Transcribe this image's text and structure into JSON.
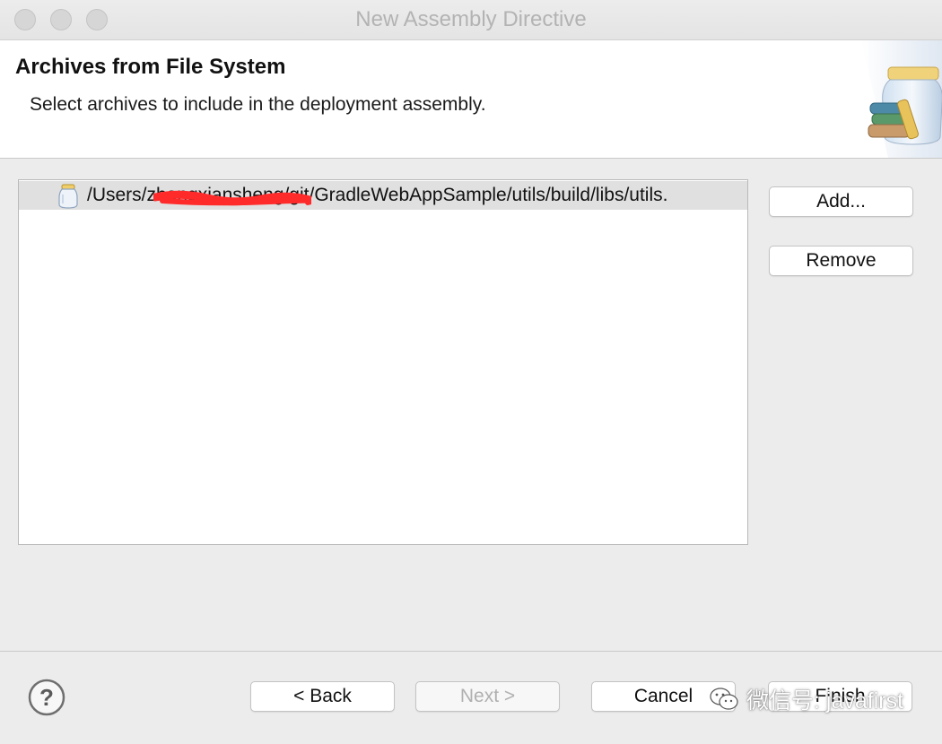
{
  "window": {
    "title": "New Assembly Directive"
  },
  "header": {
    "title": "Archives from File System",
    "description": "Select archives to include in the deployment assembly."
  },
  "archives": {
    "items": [
      {
        "path": "/Users/zhangxiansheng/git/GradleWebAppSample/utils/build/libs/utils.",
        "icon": "jar-icon"
      }
    ]
  },
  "actions": {
    "add_label": "Add...",
    "remove_label": "Remove"
  },
  "footer": {
    "back_label": "< Back",
    "next_label": "Next >",
    "cancel_label": "Cancel",
    "finish_label": "Finish"
  },
  "watermark": {
    "text": "微信号: javafirst"
  },
  "colors": {
    "redaction": "#ff2a2a",
    "disabled_text": "#b0b0b0"
  }
}
